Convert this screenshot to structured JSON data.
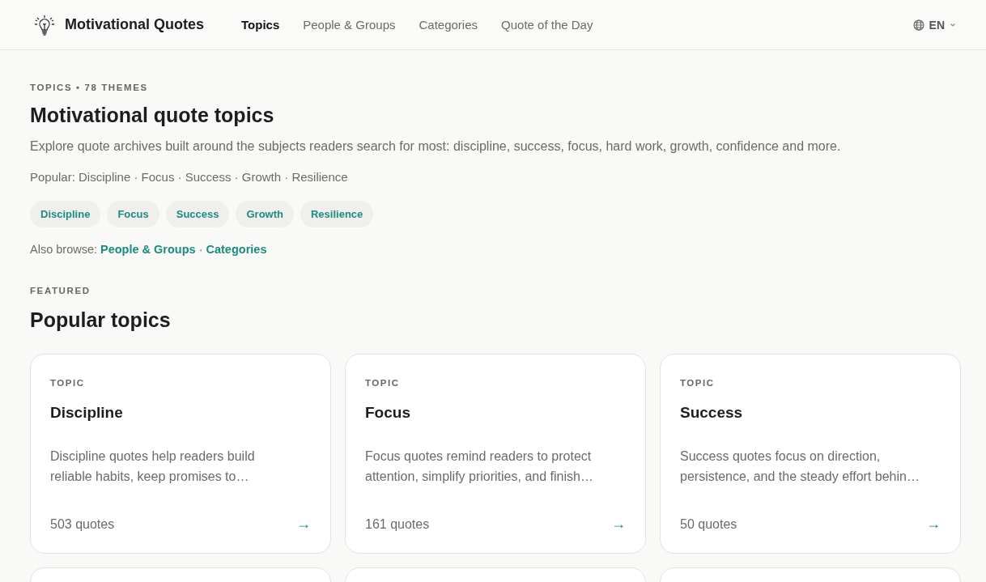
{
  "header": {
    "brand": "Motivational Quotes",
    "nav": [
      {
        "label": "Topics",
        "selected": true
      },
      {
        "label": "People & Groups",
        "selected": false
      },
      {
        "label": "Categories",
        "selected": false
      },
      {
        "label": "Quote of the Day",
        "selected": false
      }
    ],
    "language": "EN"
  },
  "intro": {
    "eyebrow": "TOPICS • 78 THEMES",
    "title": "Motivational quote topics",
    "description": "Explore quote archives built around the subjects readers search for most: discipline, success, focus, hard work, growth, confidence and more.",
    "popular": "Popular: Discipline · Focus · Success · Growth · Resilience",
    "chips": [
      "Discipline",
      "Focus",
      "Success",
      "Growth",
      "Resilience"
    ],
    "also_browse": {
      "label": "Also browse:",
      "links": [
        "People & Groups",
        "Categories"
      ],
      "separator": "·"
    }
  },
  "featured": {
    "eyebrow": "FEATURED",
    "title": "Popular topics",
    "cards": [
      {
        "kind": "topic",
        "eyebrow": "TOPIC",
        "title": "Discipline",
        "description": "Discipline quotes help readers build reliable habits, keep promises to…",
        "count": "503 quotes",
        "arrow": "→"
      },
      {
        "kind": "topic",
        "eyebrow": "TOPIC",
        "title": "Focus",
        "description": "Focus quotes remind readers to protect attention, simplify priorities, and finish…",
        "count": "161 quotes",
        "arrow": "→"
      },
      {
        "kind": "topic",
        "eyebrow": "TOPIC",
        "title": "Success",
        "description": "Success quotes focus on direction, persistence, and the steady effort behin…",
        "count": "50 quotes",
        "arrow": "→"
      },
      {
        "kind": "partial"
      },
      {
        "kind": "partial"
      },
      {
        "kind": "partial"
      }
    ]
  }
}
